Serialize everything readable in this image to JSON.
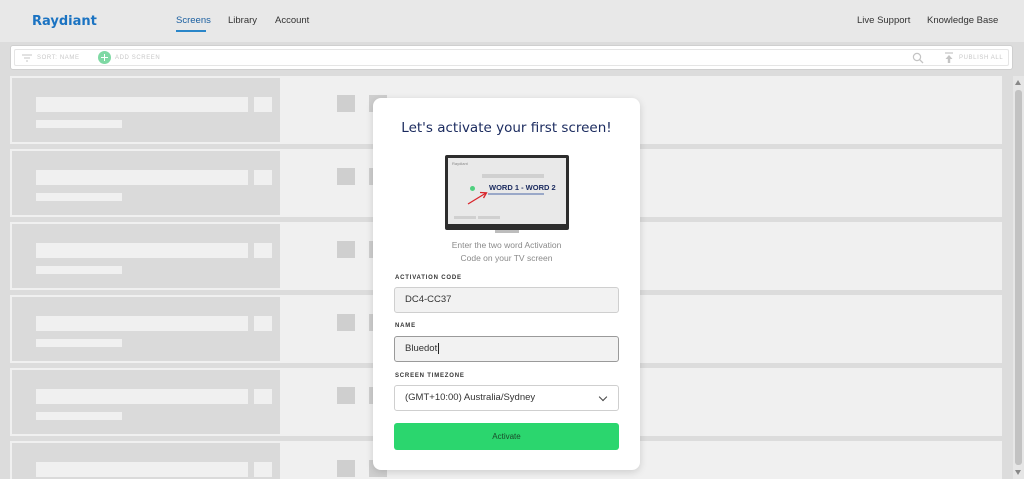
{
  "app": {
    "logo": "Raydiant"
  },
  "nav": {
    "items": [
      {
        "label": "Screens",
        "active": true
      },
      {
        "label": "Library",
        "active": false
      },
      {
        "label": "Account",
        "active": false
      }
    ],
    "right": [
      {
        "label": "Live Support"
      },
      {
        "label": "Knowledge Base"
      }
    ]
  },
  "toolbar": {
    "sort_label": "Sort: Name",
    "add_label": "Add Screen",
    "publish_label": "Publish All",
    "icons": [
      "filter-icon",
      "plus-circle-icon",
      "search-icon",
      "publish-icon"
    ]
  },
  "modal": {
    "title": "Let's activate your first screen!",
    "tv_code": "WORD 1 - WORD 2",
    "tv_logo": "Raydiant",
    "help_line1": "Enter the two word Activation",
    "help_line2": "Code on your TV screen",
    "activation_label": "Activation Code",
    "activation_value": "DC4-CC37",
    "name_label": "Name",
    "name_value": "Bluedot",
    "timezone_label": "Screen Timezone",
    "timezone_value": "(GMT+10:00) Australia/Sydney",
    "activate_label": "Activate"
  },
  "colors": {
    "brand": "#1b73c2",
    "accent_green": "#2bd66e",
    "title_navy": "#1a2a5e"
  }
}
